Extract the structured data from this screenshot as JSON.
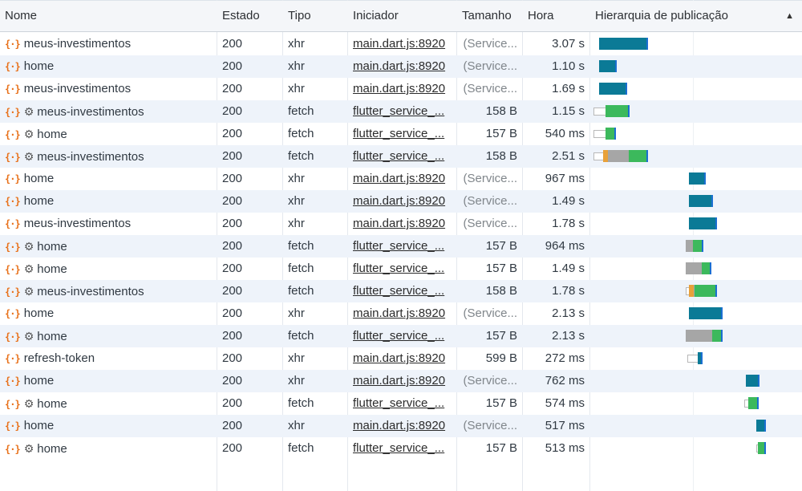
{
  "columns": {
    "name": "Nome",
    "status": "Estado",
    "type": "Tipo",
    "initiator": "Iniciador",
    "size": "Tamanho",
    "time": "Hora",
    "waterfall": "Hierarquia de publicação"
  },
  "sort_indicator": "▲",
  "colors": {
    "xhr_bar": "#0b7a96",
    "fetch_bar": "#3cb95c",
    "queue": "#a6a6a6",
    "stalled": "#e8a13a",
    "icon_orange": "#e8711a"
  },
  "rows": [
    {
      "name": "meus-investimentos",
      "service_worker": false,
      "status": "200",
      "type": "xhr",
      "initiator": "main.dart.js:8920",
      "size": "(Service...",
      "time": "3.07 s",
      "waterfall": {
        "stalled_start": null,
        "queue_start": null,
        "bar_start": 0.007,
        "bar_end": 0.07
      }
    },
    {
      "name": "home",
      "service_worker": false,
      "status": "200",
      "type": "xhr",
      "initiator": "main.dart.js:8920",
      "size": "(Service...",
      "time": "1.10 s",
      "waterfall": {
        "stalled_start": null,
        "queue_start": null,
        "bar_start": 0.007,
        "bar_end": 0.03
      }
    },
    {
      "name": "meus-investimentos",
      "service_worker": false,
      "status": "200",
      "type": "xhr",
      "initiator": "main.dart.js:8920",
      "size": "(Service...",
      "time": "1.69 s",
      "waterfall": {
        "stalled_start": null,
        "queue_start": null,
        "bar_start": 0.007,
        "bar_end": 0.043
      }
    },
    {
      "name": "meus-investimentos",
      "service_worker": true,
      "status": "200",
      "type": "fetch",
      "initiator": "flutter_service_...",
      "size": "158 B",
      "time": "1.15 s",
      "waterfall": {
        "stalled_start": 0.0,
        "queue_start": null,
        "bar_start": 0.015,
        "bar_end": 0.046
      }
    },
    {
      "name": "home",
      "service_worker": true,
      "status": "200",
      "type": "fetch",
      "initiator": "flutter_service_...",
      "size": "157 B",
      "time": "540 ms",
      "waterfall": {
        "stalled_start": 0.0,
        "queue_start": null,
        "bar_start": 0.015,
        "bar_end": 0.029
      }
    },
    {
      "name": "meus-investimentos",
      "service_worker": true,
      "status": "200",
      "type": "fetch",
      "initiator": "flutter_service_...",
      "size": "158 B",
      "time": "2.51 s",
      "waterfall": {
        "stalled_start": 0.0,
        "queue_start": 0.012,
        "bar_start": 0.045,
        "bar_end": 0.07
      }
    },
    {
      "name": "home",
      "service_worker": false,
      "status": "200",
      "type": "xhr",
      "initiator": "main.dart.js:8920",
      "size": "(Service...",
      "time": "967 ms",
      "waterfall": {
        "stalled_start": null,
        "queue_start": null,
        "bar_start": 0.122,
        "bar_end": 0.143
      }
    },
    {
      "name": "home",
      "service_worker": false,
      "status": "200",
      "type": "xhr",
      "initiator": "main.dart.js:8920",
      "size": "(Service...",
      "time": "1.49 s",
      "waterfall": {
        "stalled_start": null,
        "queue_start": null,
        "bar_start": 0.122,
        "bar_end": 0.153
      }
    },
    {
      "name": "meus-investimentos",
      "service_worker": false,
      "status": "200",
      "type": "xhr",
      "initiator": "main.dart.js:8920",
      "size": "(Service...",
      "time": "1.78 s",
      "waterfall": {
        "stalled_start": null,
        "queue_start": null,
        "bar_start": 0.122,
        "bar_end": 0.158
      }
    },
    {
      "name": "home",
      "service_worker": true,
      "status": "200",
      "type": "fetch",
      "initiator": "flutter_service_...",
      "size": "157 B",
      "time": "964 ms",
      "waterfall": {
        "stalled_start": null,
        "queue_start": 0.118,
        "bar_start": 0.127,
        "bar_end": 0.14
      }
    },
    {
      "name": "home",
      "service_worker": true,
      "status": "200",
      "type": "fetch",
      "initiator": "flutter_service_...",
      "size": "157 B",
      "time": "1.49 s",
      "waterfall": {
        "stalled_start": null,
        "queue_start": 0.118,
        "bar_start": 0.138,
        "bar_end": 0.151
      }
    },
    {
      "name": "meus-investimentos",
      "service_worker": true,
      "status": "200",
      "type": "fetch",
      "initiator": "flutter_service_...",
      "size": "158 B",
      "time": "1.78 s",
      "waterfall": {
        "stalled_start": 0.118,
        "queue_start": 0.122,
        "bar_start": 0.129,
        "bar_end": 0.158
      }
    },
    {
      "name": "home",
      "service_worker": false,
      "status": "200",
      "type": "xhr",
      "initiator": "main.dart.js:8920",
      "size": "(Service...",
      "time": "2.13 s",
      "waterfall": {
        "stalled_start": null,
        "queue_start": null,
        "bar_start": 0.122,
        "bar_end": 0.165
      }
    },
    {
      "name": "home",
      "service_worker": true,
      "status": "200",
      "type": "fetch",
      "initiator": "flutter_service_...",
      "size": "157 B",
      "time": "2.13 s",
      "waterfall": {
        "stalled_start": null,
        "queue_start": 0.118,
        "bar_start": 0.152,
        "bar_end": 0.165
      }
    },
    {
      "name": "refresh-token",
      "service_worker": false,
      "status": "200",
      "type": "xhr",
      "initiator": "main.dart.js:8920",
      "size": "599 B",
      "time": "272 ms",
      "waterfall": {
        "stalled_start": 0.12,
        "queue_start": null,
        "bar_start": 0.133,
        "bar_end": 0.139
      }
    },
    {
      "name": "home",
      "service_worker": false,
      "status": "200",
      "type": "xhr",
      "initiator": "main.dart.js:8920",
      "size": "(Service...",
      "time": "762 ms",
      "waterfall": {
        "stalled_start": null,
        "queue_start": null,
        "bar_start": 0.195,
        "bar_end": 0.212
      }
    },
    {
      "name": "home",
      "service_worker": true,
      "status": "200",
      "type": "fetch",
      "initiator": "flutter_service_...",
      "size": "157 B",
      "time": "574 ms",
      "waterfall": {
        "stalled_start": 0.192,
        "queue_start": null,
        "bar_start": 0.198,
        "bar_end": 0.211
      }
    },
    {
      "name": "home",
      "service_worker": false,
      "status": "200",
      "type": "xhr",
      "initiator": "main.dart.js:8920",
      "size": "(Service...",
      "time": "517 ms",
      "waterfall": {
        "stalled_start": null,
        "queue_start": null,
        "bar_start": 0.208,
        "bar_end": 0.22
      }
    },
    {
      "name": "home",
      "service_worker": true,
      "status": "200",
      "type": "fetch",
      "initiator": "flutter_service_...",
      "size": "157 B",
      "time": "513 ms",
      "waterfall": {
        "stalled_start": 0.208,
        "queue_start": null,
        "bar_start": 0.21,
        "bar_end": 0.22
      }
    }
  ]
}
